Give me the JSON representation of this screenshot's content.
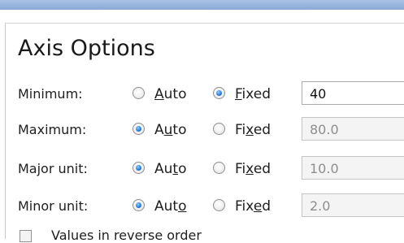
{
  "panel": {
    "title": "Axis Options"
  },
  "rows": [
    {
      "label": "Minimum:",
      "auto": {
        "before": "",
        "mnemonic": "A",
        "after": "uto",
        "checked": false
      },
      "fixed": {
        "before": "",
        "mnemonic": "F",
        "after": "ixed",
        "checked": true
      },
      "value": "40",
      "value_enabled": true
    },
    {
      "label": "Maximum:",
      "auto": {
        "before": "A",
        "mnemonic": "u",
        "after": "to",
        "checked": true
      },
      "fixed": {
        "before": "Fi",
        "mnemonic": "x",
        "after": "ed",
        "checked": false
      },
      "value": "80.0",
      "value_enabled": false
    },
    {
      "label": "Major unit:",
      "auto": {
        "before": "Au",
        "mnemonic": "t",
        "after": "o",
        "checked": true
      },
      "fixed": {
        "before": "Fi",
        "mnemonic": "x",
        "after": "ed",
        "checked": false
      },
      "value": "10.0",
      "value_enabled": false
    },
    {
      "label": "Minor unit:",
      "auto": {
        "before": "Aut",
        "mnemonic": "o",
        "after": "",
        "checked": true
      },
      "fixed": {
        "before": "Fix",
        "mnemonic": "e",
        "after": "d",
        "checked": false
      },
      "value": "2.0",
      "value_enabled": false
    }
  ],
  "reverse_order": {
    "label": "Values in reverse order",
    "checked": false
  },
  "colors": {
    "radio_selected": "#2a7fe0",
    "title_band": "#a9c3e6"
  }
}
